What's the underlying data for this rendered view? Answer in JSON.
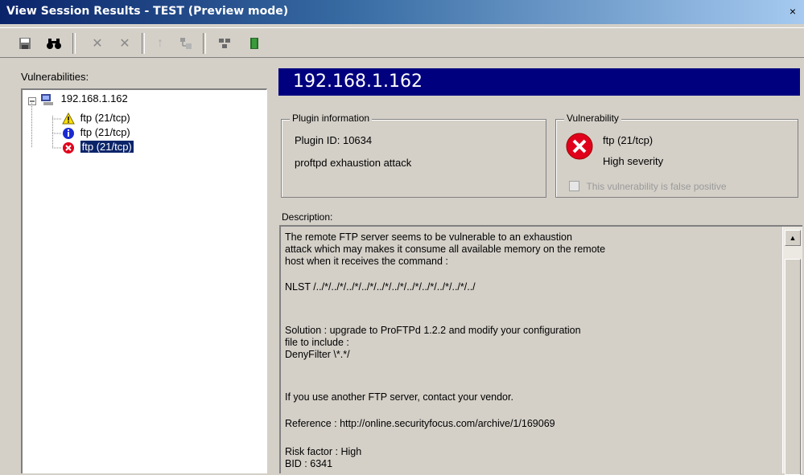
{
  "window": {
    "title": "View Session Results - TEST (Preview mode)",
    "close_glyph": "×"
  },
  "toolbar": {
    "icons": [
      "save-icon",
      "find-icon",
      "delete-icon",
      "delete-all-icon",
      "move-up-icon",
      "tree-icon",
      "network-icon",
      "exit-icon"
    ]
  },
  "left": {
    "label": "Vulnerabilities:",
    "host": "192.168.1.162",
    "items": [
      {
        "label": "ftp (21/tcp)",
        "severity": "warning"
      },
      {
        "label": "ftp (21/tcp)",
        "severity": "info"
      },
      {
        "label": "ftp (21/tcp)",
        "severity": "high",
        "selected": true
      }
    ]
  },
  "header": {
    "host": "192.168.1.162"
  },
  "plugin": {
    "legend": "Plugin information",
    "id_line": "Plugin ID: 10634",
    "name": "proftpd exhaustion attack"
  },
  "vuln": {
    "legend": "Vulnerability",
    "port": "ftp (21/tcp)",
    "severity": "High severity",
    "checkbox_label": "This vulnerability is false positive"
  },
  "description": {
    "label": "Description:",
    "lines": [
      "The remote FTP server seems to be vulnerable to an exhaustion",
      "attack which may makes it consume all available memory on the remote",
      "host when it receives the command :",
      "NLST /../*/../*/../*/../*/../*/../*/../*/../*/../*/../*/../",
      "Solution : upgrade to ProFTPd 1.2.2 and modify your configuration",
      "file to include :",
      " DenyFilter \\*.*/",
      "If you use another FTP server, contact your vendor.",
      "Reference : http://online.securityfocus.com/archive/1/169069",
      "Risk factor : High",
      "BID : 6341"
    ]
  },
  "colors": {
    "title_start": "#0a246a",
    "host_bar": "#00007f",
    "selection": "#0a246a",
    "danger": "#e0001b"
  }
}
